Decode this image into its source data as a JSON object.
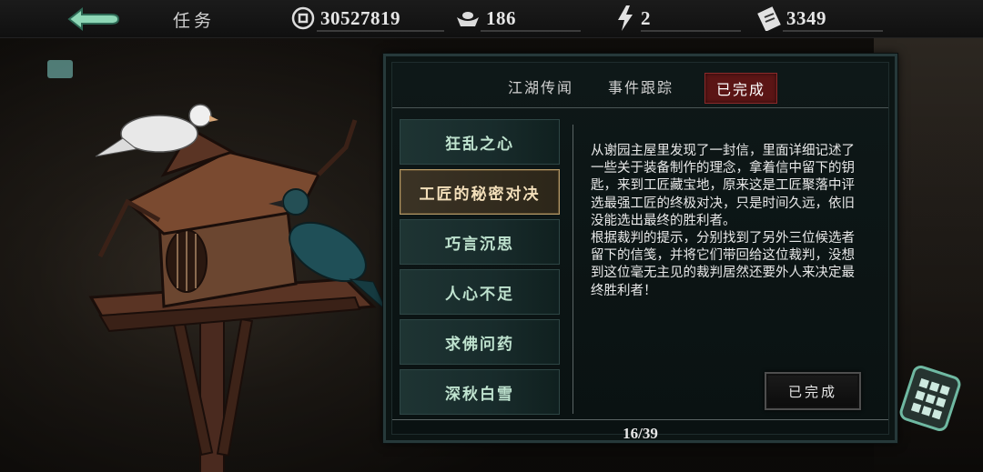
{
  "header": {
    "title": "任务",
    "back_icon": "back-arrow-icon",
    "resources": {
      "coins": {
        "icon": "coin-icon",
        "value": "30527819"
      },
      "ingots": {
        "icon": "ingot-icon",
        "value": "186"
      },
      "energy": {
        "icon": "lightning-icon",
        "value": "2"
      },
      "tickets": {
        "icon": "ticket-icon",
        "value": "3349"
      }
    }
  },
  "panel": {
    "tabs": [
      {
        "label": "江湖传闻",
        "active": false
      },
      {
        "label": "事件跟踪",
        "active": false
      },
      {
        "label": "已完成",
        "active": true
      }
    ],
    "quests": [
      {
        "label": "狂乱之心",
        "selected": false
      },
      {
        "label": "工匠的秘密对决",
        "selected": true
      },
      {
        "label": "巧言沉思",
        "selected": false
      },
      {
        "label": "人心不足",
        "selected": false
      },
      {
        "label": "求佛问药",
        "selected": false
      },
      {
        "label": "深秋白雪",
        "selected": false
      }
    ],
    "description": "从谢园主屋里发现了一封信，里面详细记述了一些关于装备制作的理念，拿着信中留下的钥匙，来到工匠藏宝地，原来这是工匠聚落中评选最强工匠的终极对决，只是时间久远，依旧没能选出最终的胜利者。\n根据裁判的提示，分别找到了另外三位候选者留下的信笺，并将它们带回给这位裁判，没想到这位毫无主见的裁判居然还要外人来决定最终胜利者！",
    "done_button": "已完成",
    "pager": "16/39"
  },
  "colors": {
    "active_tab_bg": "#5b1515",
    "quest_text": "#bfe3cf",
    "selected_border": "#b69a68",
    "panel_border": "#26393a"
  }
}
